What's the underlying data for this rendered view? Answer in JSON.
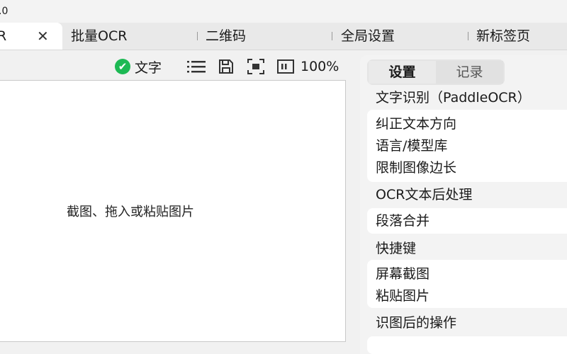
{
  "window": {
    "title": ".0"
  },
  "tabs": [
    {
      "label": "R",
      "active": true
    },
    {
      "label": "批量OCR"
    },
    {
      "label": "二维码"
    },
    {
      "label": "全局设置"
    },
    {
      "label": "新标签页"
    }
  ],
  "toolbar": {
    "mode_label": "文字",
    "zoom": "100%",
    "icons": [
      "check-icon",
      "list-icon",
      "save-icon",
      "screenshot-icon",
      "zoom-icon"
    ]
  },
  "canvas": {
    "placeholder": "截图、拖入或粘贴图片"
  },
  "panel": {
    "tabs": [
      "设置",
      "记录"
    ],
    "sections": [
      {
        "title": "文字识别（PaddleOCR）",
        "items": [
          "纠正文本方向",
          "语言/模型库",
          "限制图像边长"
        ]
      },
      {
        "title": "OCR文本后处理",
        "items": [
          "段落合并"
        ]
      },
      {
        "title": "快捷键",
        "items": [
          "屏幕截图",
          "粘贴图片"
        ]
      },
      {
        "title": "识图后的操作",
        "items": []
      }
    ]
  },
  "colors": {
    "accent_green": "#1db954",
    "background": "#f1f1f1"
  }
}
